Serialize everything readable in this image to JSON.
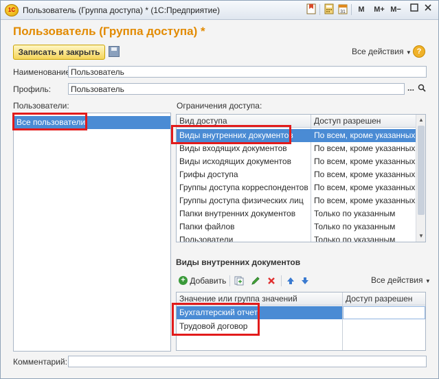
{
  "window": {
    "title": "Пользователь (Группа доступа) * (1С:Предприятие)",
    "app_logo": "1С",
    "toolbar": {
      "m": "M",
      "mplus": "M+",
      "mminus": "M−"
    }
  },
  "header": {
    "title": "Пользователь (Группа доступа) *"
  },
  "commands": {
    "save_close": "Записать и закрыть",
    "all_actions": "Все действия",
    "help": "?"
  },
  "form": {
    "name_label": "Наименование:",
    "name_value": "Пользователь",
    "profile_label": "Профиль:",
    "profile_value": "Пользователь",
    "ellipsis": "...",
    "comment_label": "Комментарий:",
    "comment_value": ""
  },
  "users": {
    "label": "Пользователи:",
    "items": [
      "Все пользователи"
    ]
  },
  "restrictions": {
    "label": "Ограничения доступа:",
    "columns": [
      "Вид доступа",
      "Доступ разрешен"
    ],
    "rows": [
      [
        "Виды внутренних документов",
        "По всем, кроме указанных"
      ],
      [
        "Виды входящих документов",
        "По всем, кроме указанных"
      ],
      [
        "Виды исходящих документов",
        "По всем, кроме указанных"
      ],
      [
        "Грифы доступа",
        "По всем, кроме указанных"
      ],
      [
        "Группы доступа корреспондентов",
        "По всем, кроме указанных"
      ],
      [
        "Группы доступа физических лиц",
        "По всем, кроме указанных"
      ],
      [
        "Папки внутренних документов",
        "Только по указанным"
      ],
      [
        "Папки файлов",
        "Только по указанным"
      ],
      [
        "Пользователи",
        "Только по указанным"
      ]
    ]
  },
  "values_section": {
    "title": "Виды внутренних документов",
    "add": "Добавить",
    "all_actions": "Все действия",
    "columns": [
      "Значение или группа значений",
      "Доступ разрешен"
    ],
    "rows": [
      "Бухгалтерский отчет",
      "Трудовой договор"
    ]
  },
  "colors": {
    "accent": "#e28a00",
    "selection": "#4a8bd4",
    "highlight": "#e21b1b"
  }
}
